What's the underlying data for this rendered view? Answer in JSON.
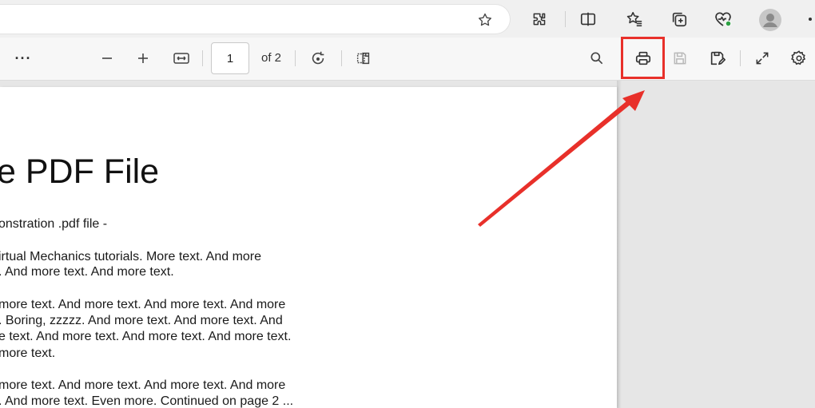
{
  "browser": {
    "favorite_icon": "star-icon",
    "toolbar_icons": [
      "extensions-icon",
      "split-screen-icon",
      "favorites-icon",
      "collections-icon",
      "browser-essentials-icon",
      "profile-avatar",
      "more-icon"
    ]
  },
  "pdf_toolbar": {
    "more_label": "···",
    "page_number": "1",
    "page_of": "of 2",
    "icons": [
      "zoom-out-icon",
      "zoom-in-icon",
      "fit-width-icon",
      "rotate-icon",
      "page-view-icon",
      "search-icon",
      "print-icon",
      "save-icon",
      "save-as-icon",
      "fullscreen-icon",
      "settings-icon"
    ]
  },
  "pdf_page": {
    "title": "e PDF File",
    "lines": [
      "onstration .pdf file -",
      "irtual Mechanics tutorials. More text. And more",
      ". And more text. And more text.",
      "more text. And more text. And more text. And more",
      ". Boring, zzzzz. And more text. And more text. And",
      "e text. And more text. And more text. And more text.",
      "more text.",
      "more text. And more text. And more text. And more",
      ". And more text. Even more. Continued on page 2 ..."
    ]
  },
  "annotation": {
    "highlight_color": "#e8302a",
    "target": "print-button"
  }
}
